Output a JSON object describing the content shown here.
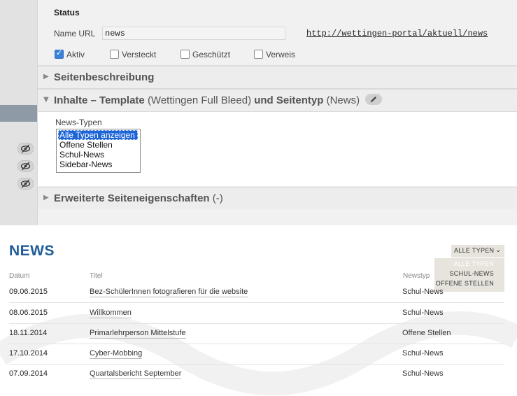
{
  "admin": {
    "status": {
      "title": "Status",
      "name_url_label": "Name URL",
      "name_url_value": "news",
      "url_link": "http://wettingen-portal/aktuell/news",
      "checkboxes": [
        {
          "label": "Aktiv",
          "checked": true
        },
        {
          "label": "Versteckt",
          "checked": false
        },
        {
          "label": "Geschützt",
          "checked": false
        },
        {
          "label": "Verweis",
          "checked": false
        }
      ]
    },
    "sections": {
      "beschreibung": "Seitenbeschreibung",
      "inhalte": {
        "bold1": "Inhalte – Template",
        "norm1": "(Wettingen Full Bleed)",
        "bold2": "und Seitentyp",
        "norm2": "(News)"
      },
      "erweitert": {
        "bold": "Erweiterte Seiteneigenschaften",
        "norm": "(-)"
      }
    },
    "news_typen": {
      "label": "News-Typen",
      "options": [
        "Alle Typen anzeigen",
        "Offene Stellen",
        "Schul-News",
        "Sidebar-News"
      ],
      "selected_index": 0
    },
    "icons": {
      "eye": "eye-slash-icon",
      "edit": "pencil-icon",
      "collapsed": "triangle-right-icon",
      "expanded": "triangle-down-icon"
    }
  },
  "site": {
    "title": "NEWS",
    "filter": {
      "label": "ALLE TYPEN",
      "menu": [
        "ALLE TYPEN",
        "SCHUL-NEWS",
        "OFFENE STELLEN"
      ]
    },
    "columns": {
      "date": "Datum",
      "title": "Titel",
      "type": "Newstyp"
    },
    "rows": [
      {
        "date": "09.06.2015",
        "title": "Bez-SchülerInnen fotografieren für die website",
        "type": "Schul-News"
      },
      {
        "date": "08.06.2015",
        "title": "Willkommen",
        "type": "Schul-News"
      },
      {
        "date": "18.11.2014",
        "title": "Primarlehrperson Mittelstufe",
        "type": "Offene Stellen"
      },
      {
        "date": "17.10.2014",
        "title": "Cyber-Mobbing",
        "type": "Schul-News"
      },
      {
        "date": "07.09.2014",
        "title": "Quartalsbericht September",
        "type": "Schul-News"
      }
    ]
  },
  "colors": {
    "accent": "#1f5c99",
    "selection": "#1d64d6",
    "checkbox": "#3b82d6"
  }
}
